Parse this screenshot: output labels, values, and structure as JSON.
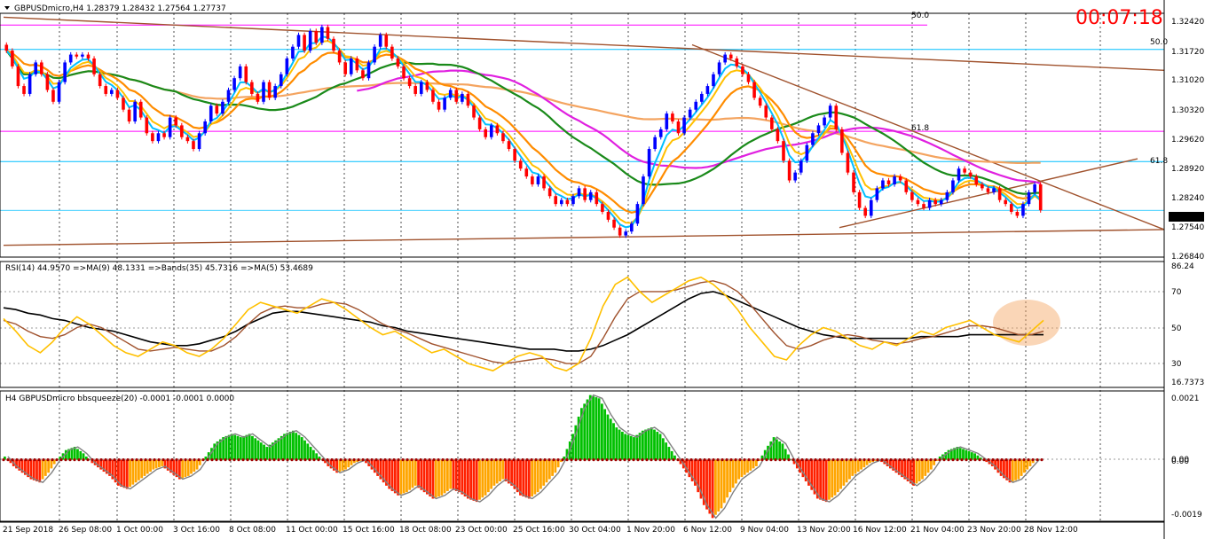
{
  "header": {
    "symbol_line": "GBPUSDmicro,H4  1.28379 1.28432 1.27564 1.27737",
    "timer": "00:07:18"
  },
  "fib_labels": [
    "50.0",
    "50.0",
    "61.8",
    "61.8"
  ],
  "price_axis": {
    "ticks": [
      "1.32420",
      "1.31720",
      "1.31020",
      "1.30320",
      "1.29620",
      "1.28920",
      "1.28240",
      "1.27540",
      "1.26840"
    ],
    "current": "1.27737"
  },
  "rsi_panel": {
    "header": "RSI(14) 44.9570  =>MA(9) 48.1331  =>Bands(35) 45.7316  =>MA(5) 53.4689",
    "ticks": [
      "86.24",
      "70",
      "50",
      "30",
      "16.7373"
    ]
  },
  "squeeze_panel": {
    "header": "H4 GBPUSDmicro bbsqueeze(20) -0.0001 -0.0001 0.0000",
    "ticks": [
      "0.0021",
      "0.00",
      "0.00",
      "-0.0019"
    ]
  },
  "time_axis": [
    "21 Sep 2018",
    "26 Sep 08:00",
    "1 Oct 00:00",
    "3 Oct 16:00",
    "8 Oct 08:00",
    "11 Oct 00:00",
    "15 Oct 16:00",
    "18 Oct 08:00",
    "23 Oct 00:00",
    "25 Oct 16:00",
    "30 Oct 04:00",
    "1 Nov 20:00",
    "6 Nov 12:00",
    "9 Nov 04:00",
    "13 Nov 20:00",
    "16 Nov 12:00",
    "21 Nov 04:00",
    "23 Nov 20:00",
    "28 Nov 12:00"
  ],
  "colors": {
    "bull_bar": "#0000ff",
    "bear_bar": "#ff0000",
    "ema_fast": "#00bfff",
    "ema_mid": "#ffc000",
    "ema_slow": "#ff8c00",
    "ma_green": "#1a8a1a",
    "ma_magenta": "#e020e0",
    "ma_tan": "#f4a460",
    "trend": "#a0522d",
    "fib": "#ff00ff",
    "fib_blue": "#00bfff",
    "rsi": "#ffc000",
    "rsi_ma": "#a0522d",
    "rsi_band": "#000000",
    "sq_pos": "#00c000",
    "sq_neg": "#ff2000",
    "sq_orange": "#ffa500"
  },
  "chart_data": [
    {
      "type": "candlestick",
      "ylim": [
        1.2655,
        1.3275
      ],
      "close": [
        1.318,
        1.314,
        1.309,
        1.307,
        1.312,
        1.315,
        1.312,
        1.308,
        1.305,
        1.31,
        1.315,
        1.317,
        1.3165,
        1.317,
        1.316,
        1.312,
        1.309,
        1.307,
        1.308,
        1.306,
        1.303,
        1.3,
        1.305,
        1.301,
        1.297,
        1.295,
        1.297,
        1.296,
        1.301,
        1.299,
        1.296,
        1.295,
        1.293,
        1.297,
        1.3,
        1.304,
        1.302,
        1.305,
        1.308,
        1.311,
        1.314,
        1.31,
        1.307,
        1.305,
        1.31,
        1.306,
        1.309,
        1.312,
        1.316,
        1.319,
        1.322,
        1.318,
        1.323,
        1.32,
        1.324,
        1.321,
        1.318,
        1.315,
        1.312,
        1.316,
        1.313,
        1.311,
        1.315,
        1.319,
        1.322,
        1.319,
        1.316,
        1.314,
        1.311,
        1.309,
        1.307,
        1.31,
        1.308,
        1.305,
        1.303,
        1.306,
        1.308,
        1.305,
        1.307,
        1.304,
        1.301,
        1.298,
        1.296,
        1.299,
        1.297,
        1.295,
        1.293,
        1.29,
        1.288,
        1.286,
        1.284,
        1.286,
        1.283,
        1.281,
        1.279,
        1.28,
        1.279,
        1.281,
        1.283,
        1.28,
        1.282,
        1.279,
        1.277,
        1.275,
        1.273,
        1.271,
        1.272,
        1.274,
        1.279,
        1.286,
        1.293,
        1.296,
        1.298,
        1.302,
        1.3,
        1.297,
        1.301,
        1.303,
        1.305,
        1.307,
        1.309,
        1.312,
        1.315,
        1.317,
        1.316,
        1.314,
        1.312,
        1.31,
        1.306,
        1.304,
        1.301,
        1.298,
        1.295,
        1.29,
        1.285,
        1.287,
        1.29,
        1.294,
        1.297,
        1.299,
        1.301,
        1.304,
        1.298,
        1.292,
        1.287,
        1.282,
        1.278,
        1.276,
        1.28,
        1.283,
        1.285,
        1.284,
        1.286,
        1.285,
        1.282,
        1.28,
        1.279,
        1.278,
        1.28,
        1.279,
        1.28,
        1.282,
        1.285,
        1.288,
        1.287,
        1.286,
        1.284,
        1.283,
        1.282,
        1.283,
        1.28,
        1.279,
        1.277,
        1.276,
        1.279,
        1.282,
        1.284,
        1.2774
      ],
      "annotations": [
        "50.0",
        "61.8"
      ]
    },
    {
      "type": "line",
      "ylim": [
        16.7373,
        86.24
      ],
      "ticks": [
        70,
        50,
        30
      ],
      "rsi": [
        55,
        48,
        40,
        36,
        42,
        50,
        56,
        52,
        46,
        40,
        36,
        34,
        38,
        42,
        40,
        36,
        34,
        38,
        44,
        52,
        60,
        64,
        62,
        60,
        58,
        62,
        66,
        64,
        60,
        55,
        50,
        46,
        48,
        44,
        40,
        36,
        38,
        34,
        30,
        28,
        26,
        30,
        34,
        36,
        34,
        28,
        26,
        30,
        44,
        62,
        74,
        78,
        70,
        64,
        68,
        72,
        76,
        78,
        74,
        68,
        60,
        50,
        42,
        34,
        32,
        40,
        46,
        50,
        48,
        44,
        40,
        38,
        42,
        40,
        44,
        48,
        46,
        50,
        52,
        54,
        50,
        46,
        44,
        42,
        48,
        54
      ],
      "rsi_ma": [
        54,
        52,
        48,
        45,
        44,
        46,
        50,
        52,
        50,
        46,
        42,
        38,
        37,
        38,
        39,
        38,
        37,
        37,
        40,
        45,
        52,
        58,
        61,
        62,
        61,
        61,
        63,
        64,
        63,
        60,
        56,
        52,
        49,
        47,
        44,
        41,
        39,
        37,
        35,
        33,
        31,
        30,
        31,
        32,
        33,
        32,
        30,
        30,
        34,
        44,
        56,
        66,
        70,
        70,
        70,
        71,
        73,
        75,
        76,
        74,
        70,
        63,
        55,
        47,
        40,
        38,
        40,
        43,
        45,
        46,
        45,
        43,
        42,
        41,
        42,
        44,
        45,
        47,
        49,
        51,
        51,
        50,
        48,
        46,
        46,
        48
      ],
      "band": [
        61,
        60,
        58,
        57,
        55,
        54,
        52,
        50,
        49,
        48,
        46,
        44,
        42,
        41,
        40,
        40,
        41,
        43,
        45,
        48,
        52,
        55,
        58,
        59,
        59,
        58,
        57,
        56,
        55,
        54,
        53,
        51,
        50,
        48,
        47,
        46,
        45,
        44,
        43,
        42,
        41,
        40,
        39,
        38,
        38,
        38,
        37,
        37,
        38,
        40,
        43,
        46,
        50,
        54,
        58,
        62,
        66,
        69,
        70,
        68,
        65,
        62,
        59,
        56,
        53,
        50,
        48,
        46,
        45,
        44,
        44,
        44,
        44,
        44,
        44,
        45,
        45,
        45,
        45,
        46,
        46,
        46,
        46,
        46,
        46,
        46
      ]
    },
    {
      "type": "bar",
      "ylim": [
        -0.0019,
        0.0021
      ],
      "values": [
        0.0001,
        -0.0002,
        -0.0004,
        -0.0006,
        -0.0007,
        -0.0004,
        0.0,
        0.0003,
        0.0004,
        0.0002,
        -0.0001,
        -0.0003,
        -0.0005,
        -0.0008,
        -0.0009,
        -0.0007,
        -0.0005,
        -0.0003,
        -0.0002,
        -0.0004,
        -0.0006,
        -0.0005,
        -0.0003,
        0.0001,
        0.0005,
        0.0007,
        0.0008,
        0.0007,
        0.0008,
        0.0006,
        0.0004,
        0.0006,
        0.0008,
        0.0009,
        0.0007,
        0.0004,
        0.0001,
        -0.0002,
        -0.0004,
        -0.0003,
        -0.0001,
        0.0,
        -0.0003,
        -0.0006,
        -0.0009,
        -0.0011,
        -0.001,
        -0.0008,
        -0.001,
        -0.0012,
        -0.0011,
        -0.0009,
        -0.001,
        -0.0012,
        -0.0013,
        -0.0011,
        -0.0008,
        -0.0006,
        -0.0008,
        -0.0011,
        -0.0012,
        -0.001,
        -0.0007,
        -0.0004,
        0.0001,
        0.0008,
        0.0016,
        0.002,
        0.0019,
        0.0014,
        0.001,
        0.0008,
        0.0007,
        0.0009,
        0.001,
        0.0008,
        0.0004,
        0.0,
        -0.0004,
        -0.0008,
        -0.0014,
        -0.0018,
        -0.0015,
        -0.001,
        -0.0006,
        -0.0004,
        -0.0002,
        0.0003,
        0.0007,
        0.0005,
        0.0,
        -0.0004,
        -0.0008,
        -0.0012,
        -0.0013,
        -0.0011,
        -0.0008,
        -0.0005,
        -0.0003,
        -0.0001,
        0.0,
        -0.0002,
        -0.0004,
        -0.0006,
        -0.0008,
        -0.0006,
        -0.0003,
        0.0001,
        0.0003,
        0.0004,
        0.0003,
        0.0002,
        0.0,
        -0.0002,
        -0.0005,
        -0.0007,
        -0.0006,
        -0.0003,
        0.0
      ]
    }
  ]
}
